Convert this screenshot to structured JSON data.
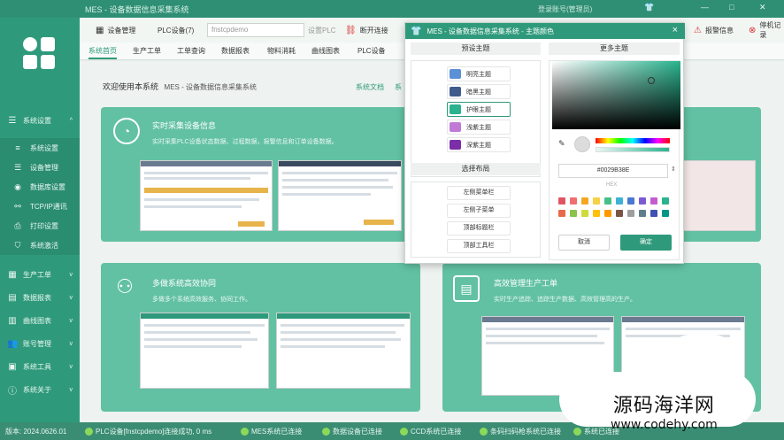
{
  "window": {
    "title": "MES - 设备数据信息采集系统",
    "user_info": "登录账号(管理员)",
    "min": "—",
    "max": "□",
    "close": "✕"
  },
  "sidebar": {
    "groups": [
      {
        "label": "系统设置",
        "icon": "settings-icon",
        "glyph": "☰",
        "chev": "^"
      },
      {
        "label": "生产工单",
        "icon": "order-icon",
        "glyph": "▦",
        "chev": "v"
      },
      {
        "label": "数据报表",
        "icon": "report-icon",
        "glyph": "▤",
        "chev": "v"
      },
      {
        "label": "曲线图表",
        "icon": "chart-icon",
        "glyph": "▥",
        "chev": "v"
      },
      {
        "label": "账号管理",
        "icon": "users-icon",
        "glyph": "👥",
        "chev": "v"
      },
      {
        "label": "系统工具",
        "icon": "toolbox-icon",
        "glyph": "▣",
        "chev": "v"
      },
      {
        "label": "系统关于",
        "icon": "info-icon",
        "glyph": "ⓘ",
        "chev": "v"
      }
    ],
    "sub_items": [
      {
        "label": "系统设置",
        "icon": "list-icon",
        "glyph": "≡"
      },
      {
        "label": "设备管理",
        "icon": "device-icon",
        "glyph": "☰"
      },
      {
        "label": "数据库设置",
        "icon": "database-icon",
        "glyph": "◉"
      },
      {
        "label": "TCP/IP通讯",
        "icon": "network-icon",
        "glyph": "⚯"
      },
      {
        "label": "打印设置",
        "icon": "printer-icon",
        "glyph": "⎙"
      },
      {
        "label": "系统激活",
        "icon": "shield-icon",
        "glyph": "⛉"
      }
    ]
  },
  "toolbar": {
    "device_mgmt": "设备管理",
    "plc_device": "PLC设备(7)",
    "input_value": "fnstcpdemo",
    "set_plc": "设置PLC",
    "disconnect": "断开连接",
    "alarm": "报警信息",
    "stop": "停机记录"
  },
  "tabs": [
    "系统首页",
    "生产工单",
    "工单查询",
    "数据报表",
    "物料消耗",
    "曲线图表",
    "PLC设备"
  ],
  "main": {
    "welcome": "欢迎使用本系统",
    "welcome_sub": "MES - 设备数据信息采集系统",
    "doc_link": "系统文档",
    "doc_link2": "系",
    "card1_title": "实时采集设备信息",
    "card1_desc": "实时采集PLC设备状态数据、过程数据，报警信息和订单设备数据。",
    "card2_title": "多做系统高效协同",
    "card2_desc": "多做多个系统高效服务、协同工作。",
    "card3_title": "高效管理生产工单",
    "card3_desc": "实时生产追踪、追踪生产数据、高效管理高的生产。"
  },
  "dialog": {
    "title": "MES - 设备数据信息采集系统 - 主题颜色",
    "preset_title": "预设主题",
    "more_title": "更多主题",
    "layout_title": "选择布局",
    "themes": [
      {
        "label": "明亮主题",
        "color": "#5b8fd6"
      },
      {
        "label": "暗黑主题",
        "color": "#3f5c8c"
      },
      {
        "label": "护眼主题",
        "color": "#29b38e"
      },
      {
        "label": "浅紫主题",
        "color": "#c07ad6"
      },
      {
        "label": "深紫主题",
        "color": "#7a2ea8"
      }
    ],
    "layouts": [
      "左侧菜单栏",
      "左侧子菜单",
      "顶部标题栏",
      "顶部工具栏"
    ],
    "hex_value": "#0029B38E",
    "hex_label": "HEX",
    "cancel": "取消",
    "ok": "确定",
    "presets": [
      "#e05563",
      "#ef6f6f",
      "#f5a623",
      "#f7d046",
      "#46c08a",
      "#3fb1d6",
      "#4a78d1",
      "#7b5bd1",
      "#c45bd1",
      "#29b38e",
      "#e86a4a",
      "#8bc34a",
      "#cddc39",
      "#ffc107",
      "#ff9800",
      "#795548",
      "#9e9e9e",
      "#607d8b",
      "#3f51b5",
      "#009688"
    ]
  },
  "statusbar": {
    "version": "版本: 2024.0626.01",
    "items": [
      "PLC设备[fnstcpdemo]连接成功, 0 ms",
      "MES系统已连接",
      "数据设备已连接",
      "CCD系统已连接",
      "条码扫码枪系统已连接",
      "系统已连接"
    ]
  },
  "watermark": {
    "line1": "源码海洋网",
    "line2": "www.codehy.com"
  }
}
